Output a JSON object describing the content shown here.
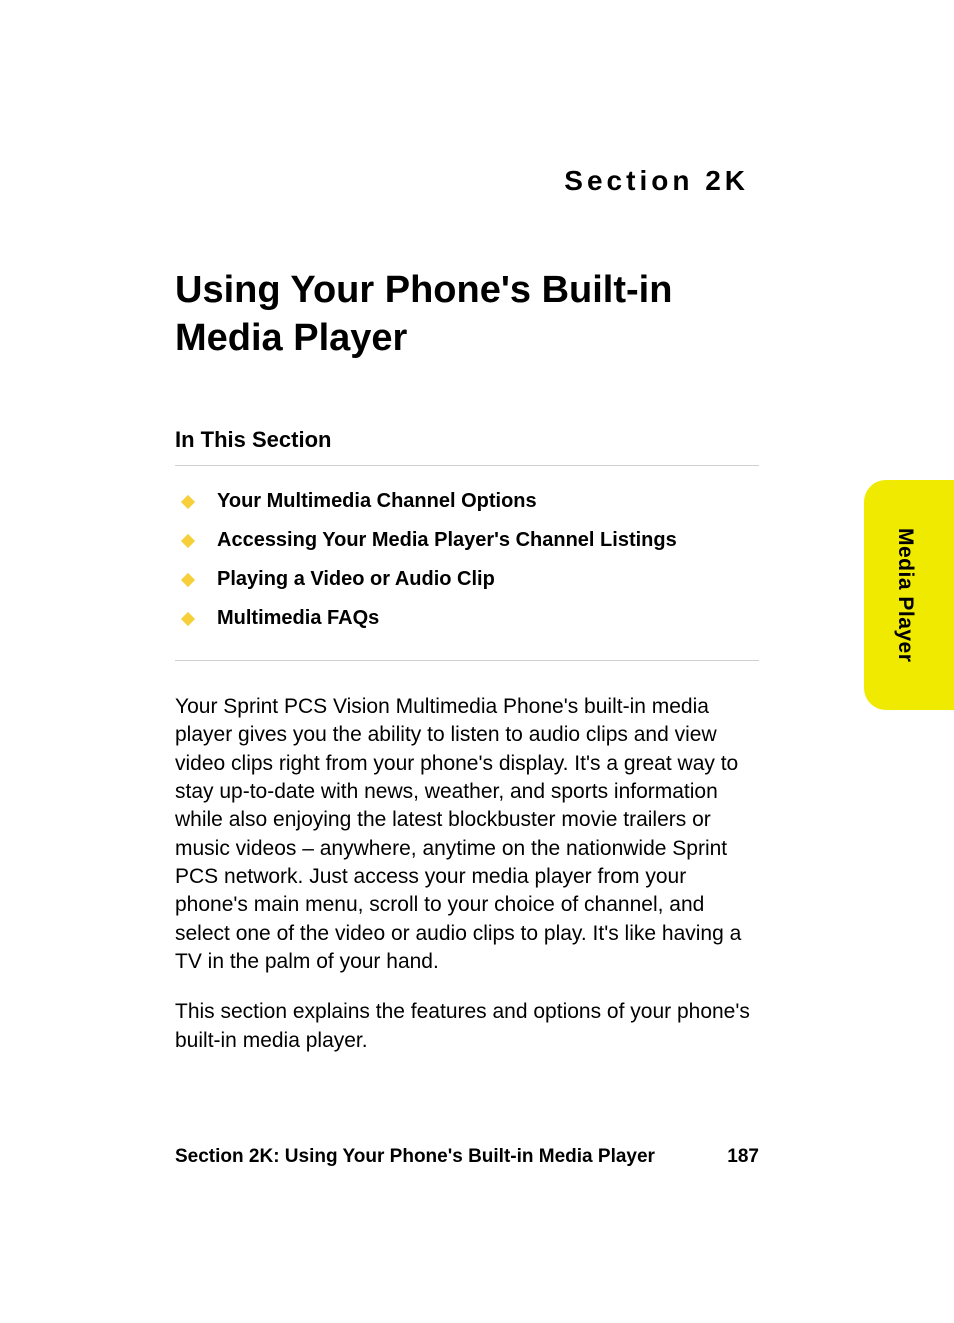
{
  "section_label": "Section 2K",
  "title": "Using Your Phone's Built-in Media Player",
  "in_this_section_label": "In This Section",
  "toc": [
    "Your Multimedia Channel Options",
    "Accessing Your Media Player's Channel Listings",
    "Playing a Video or Audio Clip",
    "Multimedia FAQs"
  ],
  "paragraphs": [
    "Your Sprint PCS Vision Multimedia Phone's built-in media player gives you the ability to listen to audio clips and view video clips right from your phone's display. It's a great way to stay up-to-date with news, weather, and sports information while also enjoying the latest blockbuster movie trailers or music videos – anywhere, anytime on the nationwide Sprint PCS network. Just access your media player from your phone's main menu, scroll to your choice of channel, and select one of the video or audio clips to play. It's like having a TV in the palm of your hand.",
    "This section explains the features and options of your phone's built-in media player."
  ],
  "side_tab": "Media Player",
  "footer": {
    "title": "Section 2K: Using Your Phone's Built-in Media Player",
    "page_number": "187"
  }
}
